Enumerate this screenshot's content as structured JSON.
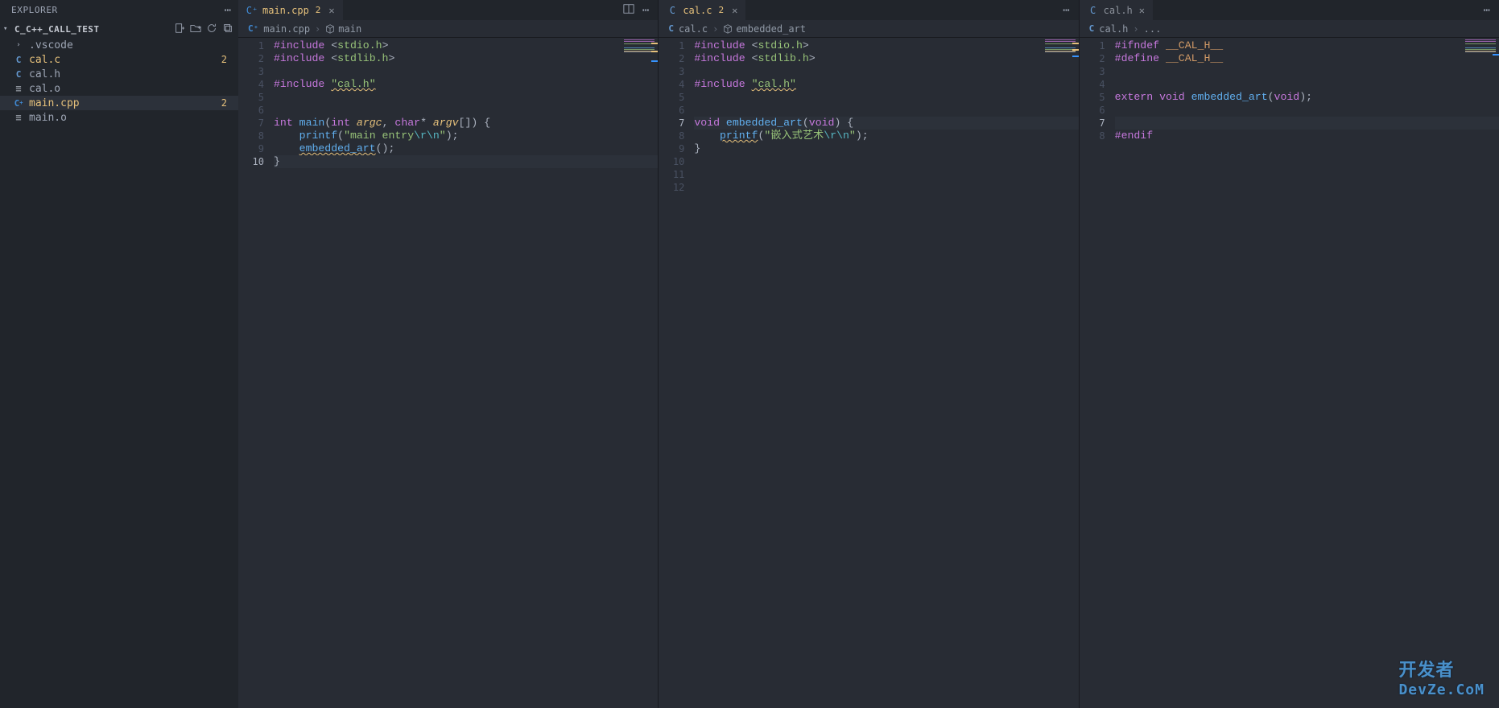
{
  "explorer": {
    "title": "EXPLORER"
  },
  "project": {
    "name": "C_C++_CALL_TEST",
    "files": [
      {
        "name": ".vscode",
        "kind": "folder",
        "modified": false
      },
      {
        "name": "cal.c",
        "kind": "c",
        "modified": true,
        "badge": "2"
      },
      {
        "name": "cal.h",
        "kind": "c",
        "modified": false
      },
      {
        "name": "cal.o",
        "kind": "generic",
        "modified": false
      },
      {
        "name": "main.cpp",
        "kind": "cpp",
        "modified": true,
        "badge": "2",
        "selected": true
      },
      {
        "name": "main.o",
        "kind": "generic",
        "modified": false
      }
    ]
  },
  "panes": [
    {
      "tab": {
        "name": "main.cpp",
        "badge": "2",
        "iconclass": "ic-cpp",
        "iconletter": "C⁺"
      },
      "breadcrumb": {
        "file": "main.cpp",
        "symbol": "main",
        "symbolKind": "function"
      },
      "currentLine": 10,
      "code": [
        {
          "n": 1,
          "t": [
            {
              "c": "pp",
              "v": "#include "
            },
            {
              "c": "br",
              "v": "<"
            },
            {
              "c": "hdr",
              "v": "stdio.h"
            },
            {
              "c": "br",
              "v": ">"
            }
          ]
        },
        {
          "n": 2,
          "t": [
            {
              "c": "pp",
              "v": "#include "
            },
            {
              "c": "br",
              "v": "<"
            },
            {
              "c": "hdr",
              "v": "stdlib.h"
            },
            {
              "c": "br",
              "v": ">"
            }
          ]
        },
        {
          "n": 3,
          "t": []
        },
        {
          "n": 4,
          "t": [
            {
              "c": "pp",
              "v": "#include "
            },
            {
              "c": "st warn-u",
              "v": "\"cal.h\""
            }
          ]
        },
        {
          "n": 5,
          "t": []
        },
        {
          "n": 6,
          "t": []
        },
        {
          "n": 7,
          "t": [
            {
              "c": "ty",
              "v": "int"
            },
            {
              "c": "op",
              "v": " "
            },
            {
              "c": "fn",
              "v": "main"
            },
            {
              "c": "br",
              "v": "("
            },
            {
              "c": "ty",
              "v": "int"
            },
            {
              "c": "op",
              "v": " "
            },
            {
              "c": "param",
              "v": "argc"
            },
            {
              "c": "op",
              "v": ", "
            },
            {
              "c": "ty",
              "v": "char"
            },
            {
              "c": "op",
              "v": "* "
            },
            {
              "c": "param",
              "v": "argv"
            },
            {
              "c": "br",
              "v": "[]"
            },
            {
              "c": "br",
              "v": ")"
            },
            {
              "c": "op",
              "v": " "
            },
            {
              "c": "br",
              "v": "{"
            }
          ]
        },
        {
          "n": 8,
          "t": [
            {
              "c": "op",
              "v": "    "
            },
            {
              "c": "fn",
              "v": "printf"
            },
            {
              "c": "br",
              "v": "("
            },
            {
              "c": "st",
              "v": "\"main entry"
            },
            {
              "c": "esc",
              "v": "\\r\\n"
            },
            {
              "c": "st",
              "v": "\""
            },
            {
              "c": "br",
              "v": ")"
            },
            {
              "c": "op",
              "v": ";"
            }
          ]
        },
        {
          "n": 9,
          "t": [
            {
              "c": "op",
              "v": "    "
            },
            {
              "c": "fn warn-u",
              "v": "embedded_art"
            },
            {
              "c": "br",
              "v": "()"
            },
            {
              "c": "op",
              "v": ";"
            }
          ]
        },
        {
          "n": 10,
          "t": [
            {
              "c": "br",
              "v": "}"
            }
          ]
        }
      ]
    },
    {
      "tab": {
        "name": "cal.c",
        "badge": "2",
        "iconclass": "ic-c",
        "iconletter": "C"
      },
      "breadcrumb": {
        "file": "cal.c",
        "symbol": "embedded_art",
        "symbolKind": "function"
      },
      "currentLine": 7,
      "code": [
        {
          "n": 1,
          "t": [
            {
              "c": "pp",
              "v": "#include "
            },
            {
              "c": "br",
              "v": "<"
            },
            {
              "c": "hdr",
              "v": "stdio.h"
            },
            {
              "c": "br",
              "v": ">"
            }
          ]
        },
        {
          "n": 2,
          "t": [
            {
              "c": "pp",
              "v": "#include "
            },
            {
              "c": "br",
              "v": "<"
            },
            {
              "c": "hdr",
              "v": "stdlib.h"
            },
            {
              "c": "br",
              "v": ">"
            }
          ]
        },
        {
          "n": 3,
          "t": []
        },
        {
          "n": 4,
          "t": [
            {
              "c": "pp",
              "v": "#include "
            },
            {
              "c": "st warn-u",
              "v": "\"cal.h\""
            }
          ]
        },
        {
          "n": 5,
          "t": []
        },
        {
          "n": 6,
          "t": []
        },
        {
          "n": 7,
          "t": [
            {
              "c": "ty",
              "v": "void"
            },
            {
              "c": "op",
              "v": " "
            },
            {
              "c": "fn",
              "v": "embedded_art"
            },
            {
              "c": "br",
              "v": "("
            },
            {
              "c": "ty",
              "v": "void"
            },
            {
              "c": "br",
              "v": ")"
            },
            {
              "c": "op",
              "v": " "
            },
            {
              "c": "br",
              "v": "{"
            }
          ]
        },
        {
          "n": 8,
          "t": [
            {
              "c": "op",
              "v": "    "
            },
            {
              "c": "fn warn-u",
              "v": "printf"
            },
            {
              "c": "br",
              "v": "("
            },
            {
              "c": "st",
              "v": "\"嵌入式艺术"
            },
            {
              "c": "esc",
              "v": "\\r\\n"
            },
            {
              "c": "st",
              "v": "\""
            },
            {
              "c": "br",
              "v": ")"
            },
            {
              "c": "op",
              "v": ";"
            }
          ]
        },
        {
          "n": 9,
          "t": [
            {
              "c": "br",
              "v": "}"
            }
          ]
        },
        {
          "n": 10,
          "t": []
        },
        {
          "n": 11,
          "t": []
        },
        {
          "n": 12,
          "t": []
        }
      ]
    },
    {
      "tab": {
        "name": "cal.h",
        "iconclass": "ic-c",
        "iconletter": "C"
      },
      "breadcrumb": {
        "file": "cal.h",
        "symbol": "...",
        "symbolKind": "ellipsis"
      },
      "currentLine": 7,
      "code": [
        {
          "n": 1,
          "t": [
            {
              "c": "pp",
              "v": "#ifndef "
            },
            {
              "c": "mac",
              "v": "__CAL_H__"
            }
          ]
        },
        {
          "n": 2,
          "t": [
            {
              "c": "pp",
              "v": "#define "
            },
            {
              "c": "mac",
              "v": "__CAL_H__"
            }
          ]
        },
        {
          "n": 3,
          "t": []
        },
        {
          "n": 4,
          "t": []
        },
        {
          "n": 5,
          "t": [
            {
              "c": "kw",
              "v": "extern"
            },
            {
              "c": "op",
              "v": " "
            },
            {
              "c": "ty",
              "v": "void"
            },
            {
              "c": "op",
              "v": " "
            },
            {
              "c": "fn",
              "v": "embedded_art"
            },
            {
              "c": "br",
              "v": "("
            },
            {
              "c": "ty",
              "v": "void"
            },
            {
              "c": "br",
              "v": ")"
            },
            {
              "c": "op",
              "v": ";"
            }
          ]
        },
        {
          "n": 6,
          "t": []
        },
        {
          "n": 7,
          "t": []
        },
        {
          "n": 8,
          "t": [
            {
              "c": "pp",
              "v": "#endif"
            }
          ]
        }
      ]
    }
  ],
  "watermark": {
    "cn": "开发者",
    "en": "DevZe.CoM"
  }
}
